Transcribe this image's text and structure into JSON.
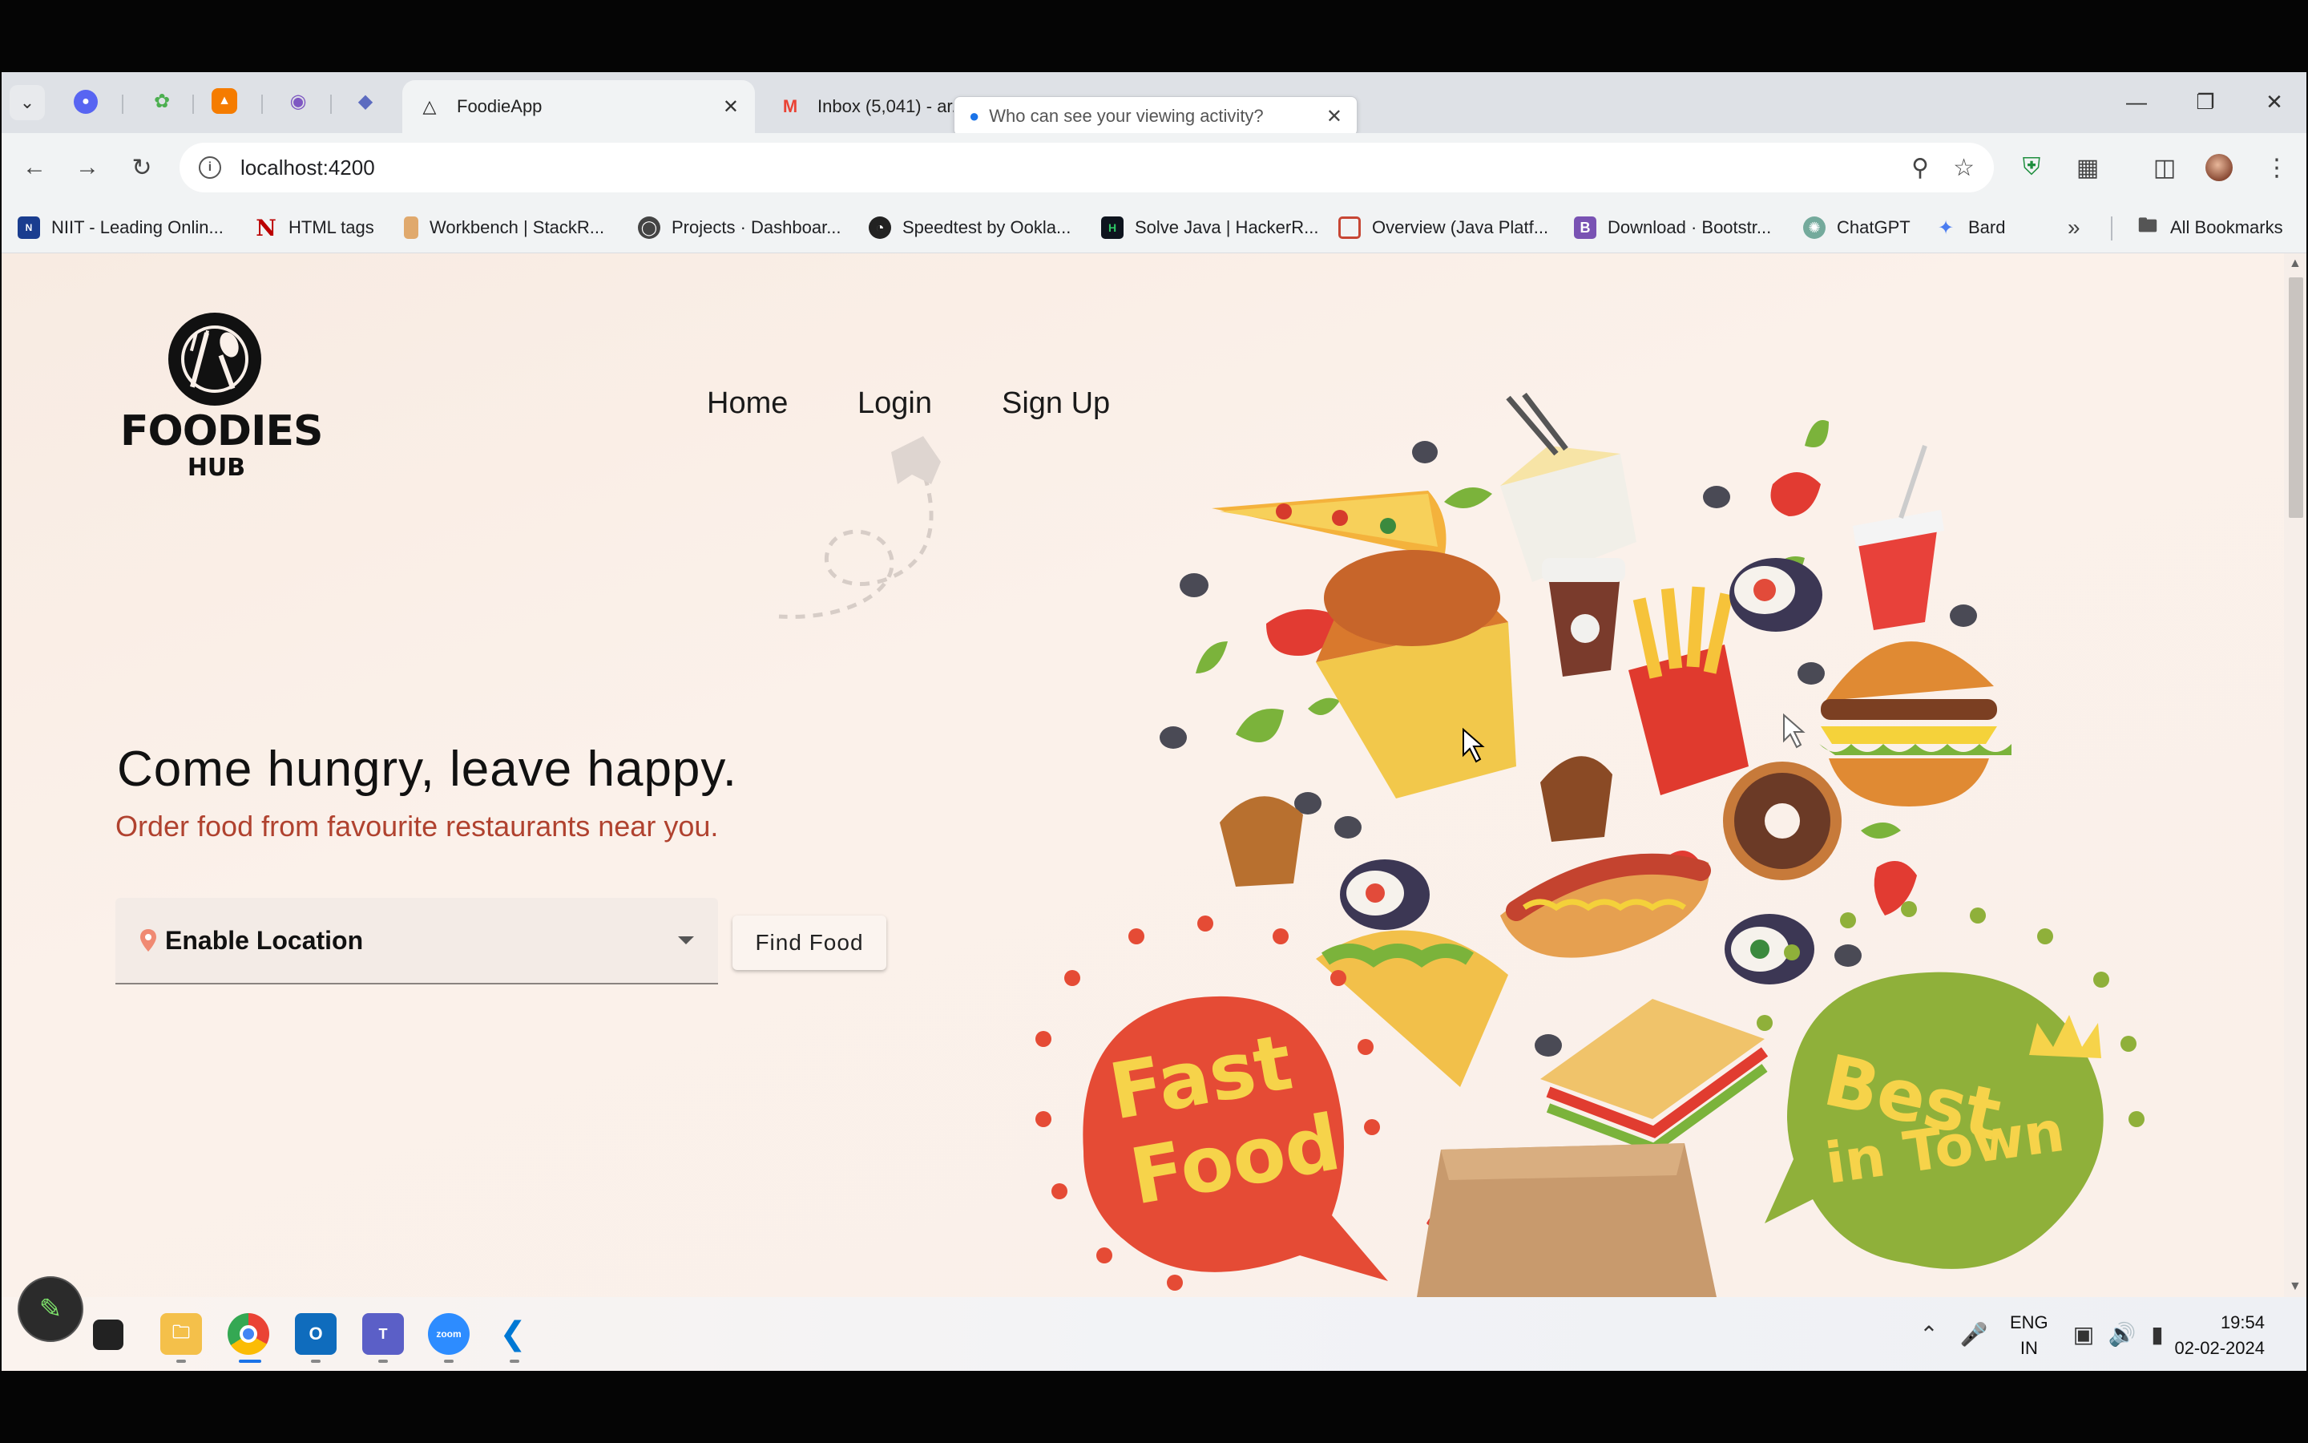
{
  "browser": {
    "tabs": [
      {
        "title": "FoodieApp",
        "active": true,
        "icon": "angular-icon"
      },
      {
        "title": "Inbox (5,041) - ar...",
        "active": false,
        "icon": "gmail-icon"
      }
    ],
    "tooltip": "Who can see your viewing activity?",
    "url": "localhost:4200",
    "bookmarks": [
      "NIIT - Leading Onlin...",
      "HTML tags",
      "Workbench | StackR...",
      "Projects · Dashboar...",
      "Speedtest by Ookla...",
      "Solve Java | HackerR...",
      "Overview (Java Platf...",
      "Download · Bootstr...",
      "ChatGPT",
      "Bard"
    ],
    "all_bookmarks": "All Bookmarks",
    "more_bookmarks": "»"
  },
  "page": {
    "logo": {
      "brand": "FOODIES",
      "sub": "HUB"
    },
    "nav": [
      "Home",
      "Login",
      "Sign Up"
    ],
    "hero_title": "Come hungry, leave happy.",
    "hero_subtitle": "Order food from favourite restaurants near you.",
    "location_select": "Enable Location",
    "find_button": "Find Food",
    "badge_left": [
      "Fast",
      "Food"
    ],
    "badge_right": [
      "Best",
      "in Town"
    ]
  },
  "taskbar": {
    "lang_top": "ENG",
    "lang_bottom": "IN",
    "time": "19:54",
    "date": "02-02-2024"
  },
  "colors": {
    "accent_red": "#b0422f",
    "fast_food_red": "#e54b35",
    "best_green": "#8fb03a",
    "badge_text_yellow": "#f6d34a"
  }
}
